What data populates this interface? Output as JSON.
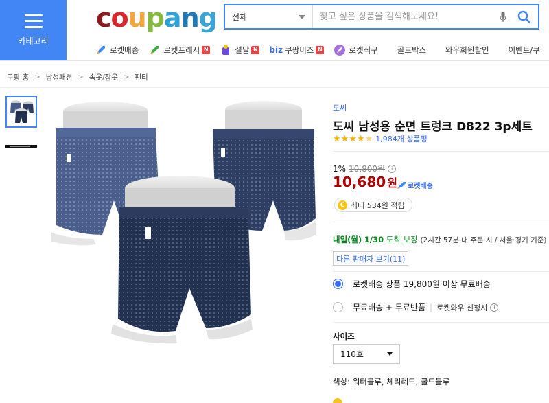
{
  "header": {
    "category_label": "카테고리",
    "logo_text": [
      "c",
      "o",
      "u",
      "p",
      "a",
      "n",
      "g"
    ],
    "search": {
      "scope": "전체",
      "placeholder": "찾고 싶은 상품을 검색해보세요!"
    },
    "nav": [
      {
        "label": "로켓배송",
        "icon": "rocket-icon",
        "badge": ""
      },
      {
        "label": "로켓프레시",
        "icon": "rocket-fresh-icon",
        "badge": "N"
      },
      {
        "label": "설날",
        "icon": "lunar-new-year-icon",
        "badge": "N"
      },
      {
        "label": "쿠팡비즈",
        "icon": "biz-icon",
        "prefix": "biz",
        "badge": "N"
      },
      {
        "label": "로켓직구",
        "icon": "rocket-global-icon",
        "badge": ""
      },
      {
        "label": "골드박스",
        "icon": "",
        "badge": ""
      },
      {
        "label": "와우회원할인",
        "icon": "",
        "badge": ""
      },
      {
        "label": "이벤트/쿠",
        "icon": "",
        "badge": ""
      }
    ]
  },
  "breadcrumb": [
    "쿠팡 홈",
    "남성패션",
    "속옷/잠옷",
    "팬티"
  ],
  "product": {
    "brand": "도씨",
    "title": "도씨 남성용 순면 트렁크 D822 3p세트",
    "rating_stars": 4.5,
    "review_count": "1,984개 상품평",
    "discount_rate": "1%",
    "original_price": "10,800원",
    "price": "10,680",
    "price_unit": "원",
    "rocket_label": "로켓배송",
    "cashback": "최대 534원 적립",
    "delivery": {
      "day": "내일(월)",
      "date": "1/30",
      "guarantee": "도착 보장",
      "detail": "(2시간 57분  내 주문 시 / 서울·경기 기준)"
    },
    "other_sellers": "다른 판매자 보기(11)",
    "shipping_options": [
      {
        "label": "로켓배송 상품 19,800원 이상 무료배송",
        "selected": true,
        "sub": ""
      },
      {
        "label": "무료배송 + 무료반품",
        "selected": false,
        "sub": "로켓와우 신청시"
      }
    ],
    "size_label": "사이즈",
    "size_value": "110호",
    "color_line": "색상: 워터블루, 체리레드, 쿨드블루"
  },
  "colors": {
    "accent": "#4285f4",
    "link": "#346aff",
    "price_red": "#ae0000",
    "delivery_green": "#00891a",
    "star": "#f5b400"
  }
}
